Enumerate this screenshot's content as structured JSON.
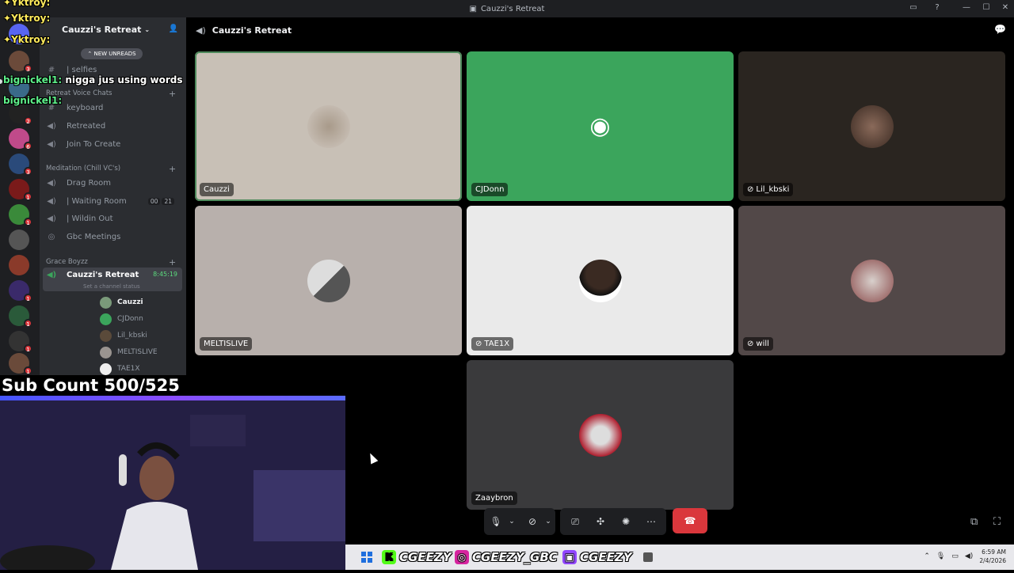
{
  "window": {
    "title": "Cauzzi's Retreat"
  },
  "guild": {
    "name": "Cauzzi's Retreat",
    "new_unreads": "NEW UNREADS"
  },
  "channels": {
    "top": [
      {
        "name": "| selfies",
        "icon": "hash-icon"
      },
      {
        "name": "keyboard",
        "icon": "hash-icon"
      }
    ],
    "category1": "Retreat Voice Chats",
    "voice1": [
      {
        "name": "Retreated",
        "icon": "speaker-icon"
      },
      {
        "name": "Join To Create",
        "icon": "speaker-icon"
      }
    ],
    "category2": "Meditation (Chill VC's)",
    "voice2": [
      {
        "name": "Drag Room"
      },
      {
        "name": "| Waiting Room",
        "count_a": "00",
        "count_b": "21"
      },
      {
        "name": "| Wildin Out"
      },
      {
        "name": "Gbc Meetings"
      }
    ],
    "category3": "Grace Boyzz",
    "active": {
      "name": "Cauzzi's Retreat",
      "time": "8:45:19",
      "status": "Set a channel status"
    },
    "members": [
      "Cauzzi",
      "CJDonn",
      "Lil_kbski",
      "MELTISLIVE",
      "TAE1X"
    ]
  },
  "chat_overlay": [
    {
      "name": "Yktroy:",
      "msg": ""
    },
    {
      "name": "Yktroy:",
      "msg": ""
    },
    {
      "name": "Yktroy:",
      "msg": ""
    },
    {
      "name": "bignickel1:",
      "msg": "nigga jus using words"
    },
    {
      "name": "bignickel1:",
      "msg": ""
    }
  ],
  "voice_header": {
    "title": "Cauzzi's Retreat"
  },
  "tiles": [
    {
      "name": "Cauzzi",
      "bg": "#c8c0b6",
      "muted": false
    },
    {
      "name": "CJDonn",
      "bg": "#3ba55c",
      "muted": false
    },
    {
      "name": "Lil_kbski",
      "bg": "#2a2520",
      "muted": true
    },
    {
      "name": "MELTISLIVE",
      "bg": "#b8b0ac",
      "muted": false
    },
    {
      "name": "TAE1X",
      "bg": "#eaeaea",
      "muted": true
    },
    {
      "name": "will",
      "bg": "#524848",
      "muted": true
    },
    {
      "name": "Zaaybron",
      "bg": "#3a3a3c",
      "muted": false
    }
  ],
  "stream": {
    "sub_count": "Sub Count 500/525"
  },
  "socials": [
    {
      "platform": "kick",
      "handle": "CGEEZY"
    },
    {
      "platform": "instagram",
      "handle": "CGEEZY_GBC"
    },
    {
      "platform": "twitch",
      "handle": "CGEEZY"
    }
  ],
  "clock": {
    "time": "6:59 AM",
    "date": "2/4/2026"
  },
  "colors": {
    "accent_green": "#3ba55c",
    "hangup_red": "#da373c",
    "badge_red": "#da373c"
  }
}
